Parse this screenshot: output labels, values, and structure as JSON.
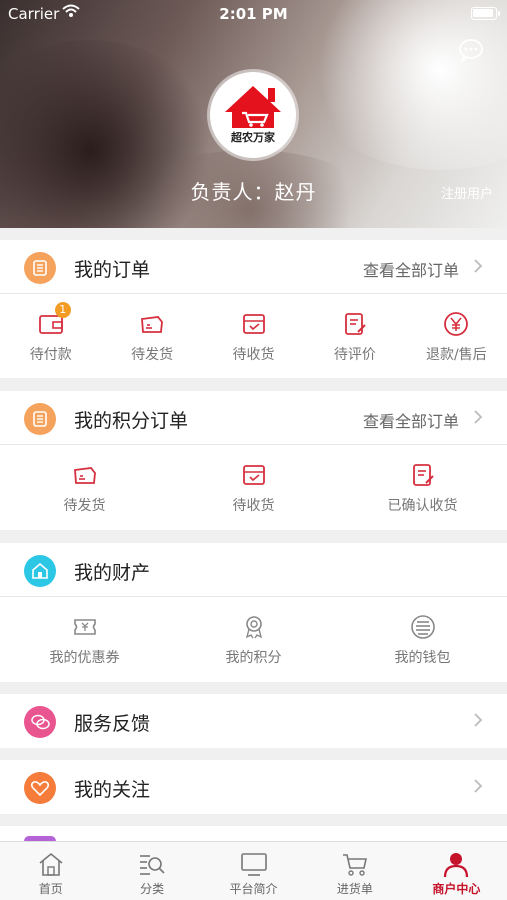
{
  "status_bar": {
    "carrier": "Carrier",
    "time": "2:01 PM"
  },
  "header": {
    "logo_text": "超农万家",
    "owner": "负责人：赵丹",
    "register_link": "注册用户"
  },
  "orders": {
    "title": "我的订单",
    "view_all": "查看全部订单",
    "items": [
      {
        "label": "待付款",
        "icon": "wallet-icon",
        "badge": "1"
      },
      {
        "label": "待发货",
        "icon": "truck-icon"
      },
      {
        "label": "待收货",
        "icon": "box-icon"
      },
      {
        "label": "待评价",
        "icon": "review-icon"
      },
      {
        "label": "退款/售后",
        "icon": "yen-icon"
      }
    ]
  },
  "points_orders": {
    "title": "我的积分订单",
    "view_all": "查看全部订单",
    "items": [
      {
        "label": "待发货",
        "icon": "truck-icon"
      },
      {
        "label": "待收货",
        "icon": "box-icon"
      },
      {
        "label": "已确认收货",
        "icon": "review-icon"
      }
    ]
  },
  "assets": {
    "title": "我的财产",
    "items": [
      {
        "label": "我的优惠券",
        "icon": "coupon-icon"
      },
      {
        "label": "我的积分",
        "icon": "medal-icon"
      },
      {
        "label": "我的钱包",
        "icon": "coins-icon"
      }
    ]
  },
  "feedback": {
    "title": "服务反馈"
  },
  "follow": {
    "title": "我的关注"
  },
  "tabbar": [
    {
      "label": "首页",
      "icon": "home-icon"
    },
    {
      "label": "分类",
      "icon": "category-search-icon"
    },
    {
      "label": "平台简介",
      "icon": "monitor-icon"
    },
    {
      "label": "进货单",
      "icon": "cart-icon"
    },
    {
      "label": "商户中心",
      "icon": "user-icon",
      "active": true
    }
  ],
  "colors": {
    "accent": "#c5132b",
    "orange": "#f5a25d",
    "cyan": "#2dc7e6",
    "pink": "#e9558f",
    "orange2": "#f57c3a"
  }
}
